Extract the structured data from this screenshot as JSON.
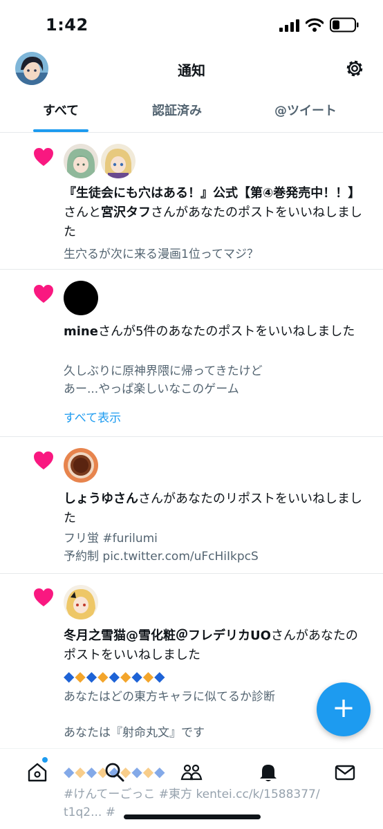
{
  "status": {
    "time": "1:42"
  },
  "header": {
    "title": "通知"
  },
  "tabs": [
    {
      "label": "すべて",
      "active": true
    },
    {
      "label": "認証済み",
      "active": false
    },
    {
      "label": "@ツイート",
      "active": false
    }
  ],
  "notifications": [
    {
      "type": "like",
      "actors": [
        "『生徒会にも穴はある！』公式【第④巻発売中！！】",
        "宮沢タフ"
      ],
      "text_parts": [
        "『生徒会にも穴はある！』公式【第④巻発売中！！】",
        "さんと",
        "宮沢タフ",
        "さんがあなたのポストをいいねしました"
      ],
      "preview": [
        "生穴るが次に来る漫画1位ってマジ？"
      ]
    },
    {
      "type": "like",
      "text_parts": [
        "mine",
        "さんが5件のあなたのポストをいいねしました"
      ],
      "preview": [
        "久しぶりに原神界隈に帰ってきたけど",
        "あー...やっぱ楽しいなこのゲーム"
      ],
      "show_all": "すべて表示"
    },
    {
      "type": "like",
      "text_parts": [
        "しょうゆさん",
        "さんがあなたのリポストをいいねしました"
      ],
      "preview": [
        "フリ蛍 #furilumi",
        "予約制 pic.twitter.com/uFcHiIkpcS"
      ]
    },
    {
      "type": "like",
      "text_parts": [
        "冬月之雪猫@雪化粧＠フレデリカUO",
        "さんがあなたのポストをいいねしました"
      ],
      "preview": [
        "あなたはどの東方キャラに似てるか診断",
        "",
        "あなたは『射命丸文』です"
      ],
      "preview_tail": [
        "#けんてーごっこ #東方 kentei.cc/k/1588377/",
        "t1q2... #"
      ]
    }
  ],
  "nav": [
    "home-icon",
    "search-icon",
    "communities-icon",
    "notifications-icon",
    "messages-icon"
  ],
  "colors": {
    "accent": "#1d9bf0",
    "like": "#f91880"
  }
}
